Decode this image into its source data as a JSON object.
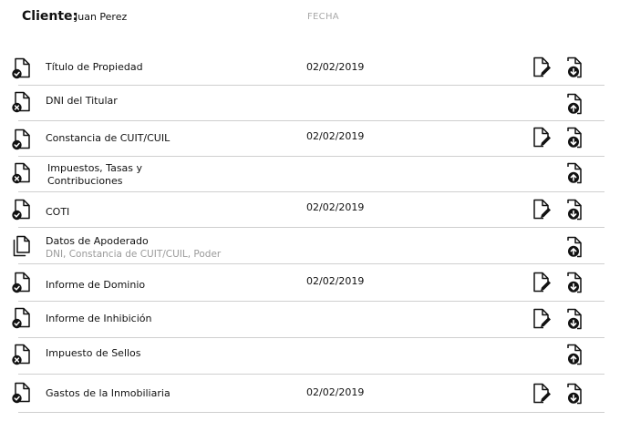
{
  "header": {
    "client_label": "Cliente:",
    "client_name": "Juan Perez",
    "date_column": "FECHA"
  },
  "documents": [
    {
      "name": "Título de Propiedad",
      "subtitle": "",
      "date": "02/02/2019",
      "status_icon": "file-check-icon",
      "editable": true,
      "action_icon": "download-icon"
    },
    {
      "name": "DNI del Titular",
      "subtitle": "",
      "date": "",
      "status_icon": "file-x-icon",
      "editable": false,
      "action_icon": "upload-icon"
    },
    {
      "name": "Constancia de CUIT/CUIL",
      "subtitle": "",
      "date": "02/02/2019",
      "status_icon": "file-check-icon",
      "editable": true,
      "action_icon": "download-icon"
    },
    {
      "name": "Impuestos, Tasas y Contribuciones",
      "subtitle": "",
      "date": "",
      "status_icon": "file-x-icon",
      "editable": false,
      "action_icon": "upload-icon"
    },
    {
      "name": "COTI",
      "subtitle": "",
      "date": "02/02/2019",
      "status_icon": "file-check-icon",
      "editable": true,
      "action_icon": "download-icon"
    },
    {
      "name": "Datos de Apoderado",
      "subtitle": "DNI, Constancia de CUIT/CUIL, Poder",
      "date": "",
      "status_icon": "files-icon",
      "editable": false,
      "action_icon": "upload-icon"
    },
    {
      "name": "Informe de Dominio",
      "subtitle": "",
      "date": "02/02/2019",
      "status_icon": "file-check-icon",
      "editable": true,
      "action_icon": "download-icon"
    },
    {
      "name": "Informe de Inhibición",
      "subtitle": "",
      "date": "",
      "status_icon": "file-check-icon",
      "editable": true,
      "action_icon": "download-icon"
    },
    {
      "name": "Impuesto de Sellos",
      "subtitle": "",
      "date": "",
      "status_icon": "file-x-icon",
      "editable": false,
      "action_icon": "upload-icon"
    },
    {
      "name": "Gastos de la Inmobiliaria",
      "subtitle": "",
      "date": "02/02/2019",
      "status_icon": "file-check-icon",
      "editable": true,
      "action_icon": "download-icon"
    }
  ]
}
